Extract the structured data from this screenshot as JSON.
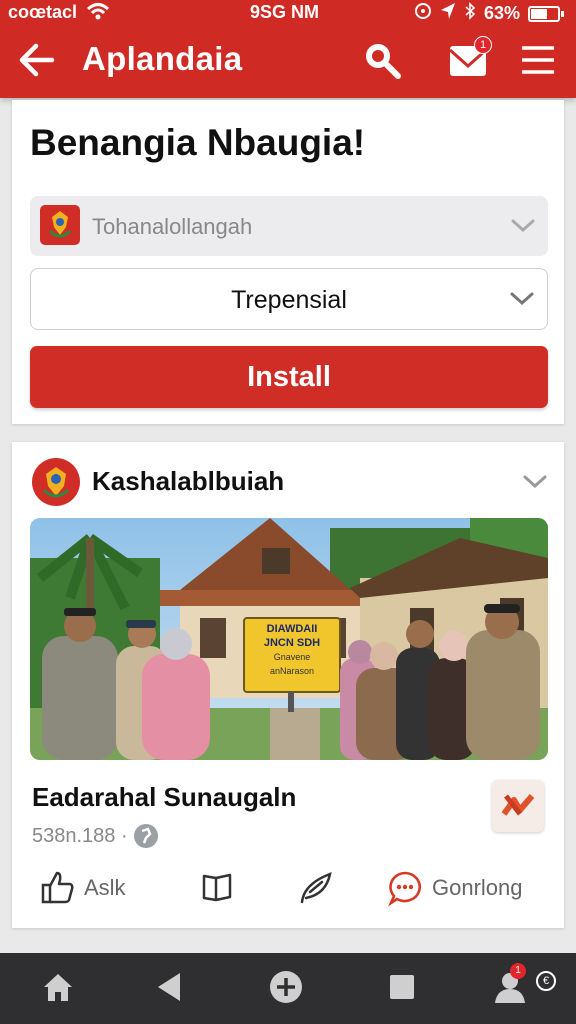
{
  "status_bar": {
    "carrier": "coœtacl",
    "time": "9SG NM",
    "battery": "63%",
    "battery_level": 0.63
  },
  "app_bar": {
    "title": "Aplandaia",
    "notification_count": "1"
  },
  "card1": {
    "title": "Benangia Nbaugia!",
    "select_region": "Tohanalollangah",
    "select_type": "Trepensial",
    "install_label": "Install"
  },
  "post": {
    "org_name": "Kashalablbuiah",
    "image_sign": {
      "line1": "DIAWDAII",
      "line2": "JNCN SDH",
      "line3": "Gnavene",
      "line4": "anNarason"
    },
    "title": "Eadarahal Sunaugaln",
    "meta": "538n.188 ·",
    "actions": {
      "like": "Aslk",
      "comment": "Gonrlong"
    }
  },
  "bottom_nav": {
    "profile_badge": "1",
    "extra_label": "€"
  },
  "colors": {
    "brand_red": "#d02a25",
    "nav_dark": "#2f2f31"
  }
}
